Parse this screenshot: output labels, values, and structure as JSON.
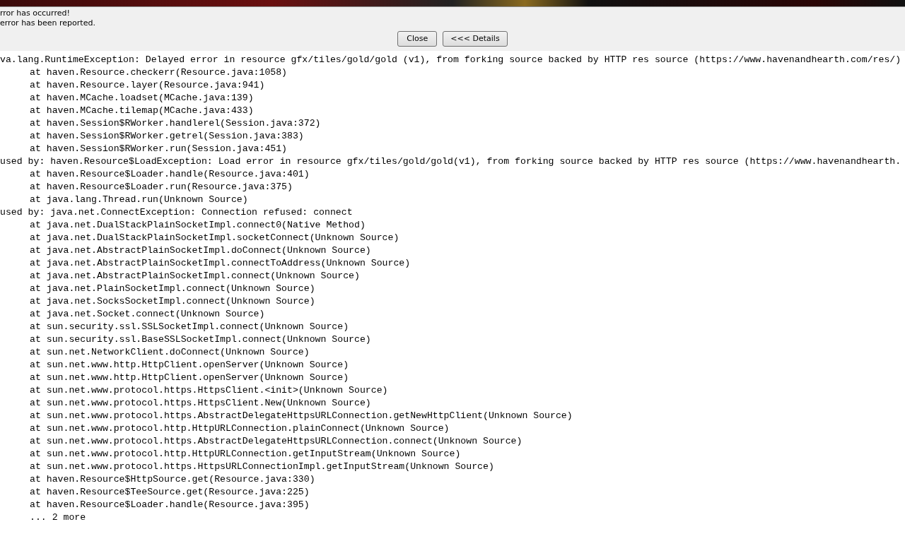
{
  "messages": [
    "rror has occurred!",
    "error has been reported."
  ],
  "buttons": [
    "Close",
    "<<< Details"
  ],
  "trace": [
    {
      "kind": "header",
      "text": "va.lang.RuntimeException: Delayed error in resource gfx/tiles/gold/gold (v1), from forking source backed by HTTP res source (https://www.havenandhearth.com/res/)"
    },
    {
      "kind": "frame",
      "text": "at haven.Resource.checkerr(Resource.java:1058)"
    },
    {
      "kind": "frame",
      "text": "at haven.Resource.layer(Resource.java:941)"
    },
    {
      "kind": "frame",
      "text": "at haven.MCache.loadset(MCache.java:139)"
    },
    {
      "kind": "frame",
      "text": "at haven.MCache.tilemap(MCache.java:433)"
    },
    {
      "kind": "frame",
      "text": "at haven.Session$RWorker.handlerel(Session.java:372)"
    },
    {
      "kind": "frame",
      "text": "at haven.Session$RWorker.getrel(Session.java:383)"
    },
    {
      "kind": "frame",
      "text": "at haven.Session$RWorker.run(Session.java:451)"
    },
    {
      "kind": "header",
      "text": "used by: haven.Resource$LoadException: Load error in resource gfx/tiles/gold/gold(v1), from forking source backed by HTTP res source (https://www.havenandhearth."
    },
    {
      "kind": "frame",
      "text": "at haven.Resource$Loader.handle(Resource.java:401)"
    },
    {
      "kind": "frame",
      "text": "at haven.Resource$Loader.run(Resource.java:375)"
    },
    {
      "kind": "frame",
      "text": "at java.lang.Thread.run(Unknown Source)"
    },
    {
      "kind": "header",
      "text": "used by: java.net.ConnectException: Connection refused: connect"
    },
    {
      "kind": "frame",
      "text": "at java.net.DualStackPlainSocketImpl.connect0(Native Method)"
    },
    {
      "kind": "frame",
      "text": "at java.net.DualStackPlainSocketImpl.socketConnect(Unknown Source)"
    },
    {
      "kind": "frame",
      "text": "at java.net.AbstractPlainSocketImpl.doConnect(Unknown Source)"
    },
    {
      "kind": "frame",
      "text": "at java.net.AbstractPlainSocketImpl.connectToAddress(Unknown Source)"
    },
    {
      "kind": "frame",
      "text": "at java.net.AbstractPlainSocketImpl.connect(Unknown Source)"
    },
    {
      "kind": "frame",
      "text": "at java.net.PlainSocketImpl.connect(Unknown Source)"
    },
    {
      "kind": "frame",
      "text": "at java.net.SocksSocketImpl.connect(Unknown Source)"
    },
    {
      "kind": "frame",
      "text": "at java.net.Socket.connect(Unknown Source)"
    },
    {
      "kind": "frame",
      "text": "at sun.security.ssl.SSLSocketImpl.connect(Unknown Source)"
    },
    {
      "kind": "frame",
      "text": "at sun.security.ssl.BaseSSLSocketImpl.connect(Unknown Source)"
    },
    {
      "kind": "frame",
      "text": "at sun.net.NetworkClient.doConnect(Unknown Source)"
    },
    {
      "kind": "frame",
      "text": "at sun.net.www.http.HttpClient.openServer(Unknown Source)"
    },
    {
      "kind": "frame",
      "text": "at sun.net.www.http.HttpClient.openServer(Unknown Source)"
    },
    {
      "kind": "frame",
      "text": "at sun.net.www.protocol.https.HttpsClient.<init>(Unknown Source)"
    },
    {
      "kind": "frame",
      "text": "at sun.net.www.protocol.https.HttpsClient.New(Unknown Source)"
    },
    {
      "kind": "frame",
      "text": "at sun.net.www.protocol.https.AbstractDelegateHttpsURLConnection.getNewHttpClient(Unknown Source)"
    },
    {
      "kind": "frame",
      "text": "at sun.net.www.protocol.http.HttpURLConnection.plainConnect(Unknown Source)"
    },
    {
      "kind": "frame",
      "text": "at sun.net.www.protocol.https.AbstractDelegateHttpsURLConnection.connect(Unknown Source)"
    },
    {
      "kind": "frame",
      "text": "at sun.net.www.protocol.http.HttpURLConnection.getInputStream(Unknown Source)"
    },
    {
      "kind": "frame",
      "text": "at sun.net.www.protocol.https.HttpsURLConnectionImpl.getInputStream(Unknown Source)"
    },
    {
      "kind": "frame",
      "text": "at haven.Resource$HttpSource.get(Resource.java:330)"
    },
    {
      "kind": "frame",
      "text": "at haven.Resource$TeeSource.get(Resource.java:225)"
    },
    {
      "kind": "frame",
      "text": "at haven.Resource$Loader.handle(Resource.java:395)"
    },
    {
      "kind": "frame",
      "text": "... 2 more"
    }
  ]
}
